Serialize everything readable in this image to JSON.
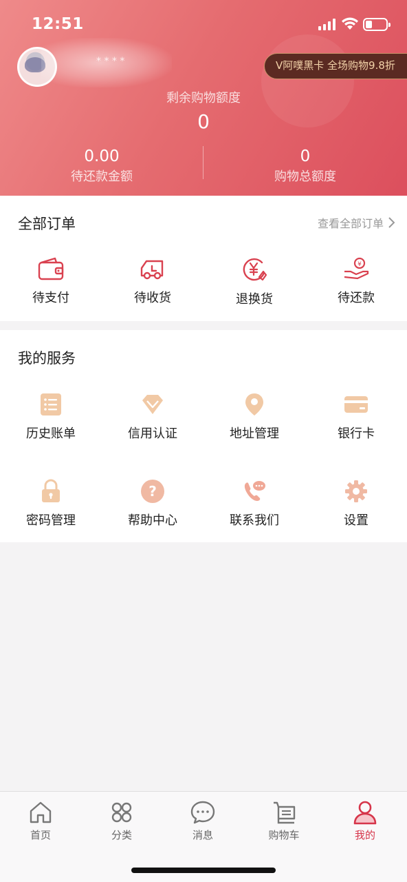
{
  "status_bar": {
    "time": "12:51"
  },
  "header": {
    "username": "* * * *",
    "vip_badge": "V阿噗黑卡 全场购物9.8折",
    "quota_label": "剩余购物额度",
    "quota_value": "0",
    "stats": [
      {
        "value": "0.00",
        "label": "待还款金额"
      },
      {
        "value": "0",
        "label": "购物总额度"
      }
    ]
  },
  "orders": {
    "title": "全部订单",
    "view_all": "查看全部订单",
    "items": [
      {
        "label": "待支付",
        "icon": "wallet-icon"
      },
      {
        "label": "待收货",
        "icon": "truck-icon"
      },
      {
        "label": "退换货",
        "icon": "yen-exchange-icon"
      },
      {
        "label": "待还款",
        "icon": "hand-coin-icon"
      }
    ]
  },
  "services": {
    "title": "我的服务",
    "items": [
      {
        "label": "历史账单",
        "icon": "bill-list-icon"
      },
      {
        "label": "信用认证",
        "icon": "diamond-icon"
      },
      {
        "label": "地址管理",
        "icon": "location-pin-icon"
      },
      {
        "label": "银行卡",
        "icon": "bank-card-icon"
      },
      {
        "label": "密码管理",
        "icon": "lock-icon"
      },
      {
        "label": "帮助中心",
        "icon": "help-icon"
      },
      {
        "label": "联系我们",
        "icon": "phone-chat-icon"
      },
      {
        "label": "设置",
        "icon": "gear-icon"
      }
    ]
  },
  "tabbar": {
    "items": [
      {
        "label": "首页",
        "icon": "home-icon"
      },
      {
        "label": "分类",
        "icon": "category-icon"
      },
      {
        "label": "消息",
        "icon": "message-icon"
      },
      {
        "label": "购物车",
        "icon": "cart-icon"
      },
      {
        "label": "我的",
        "icon": "user-icon",
        "active": true
      }
    ]
  },
  "colors": {
    "accent": "#d6354a",
    "header_start": "#ef8a8a",
    "header_end": "#dc4f5d",
    "order_icon": "#d9414f",
    "service_icon": "#f1c9a5"
  }
}
